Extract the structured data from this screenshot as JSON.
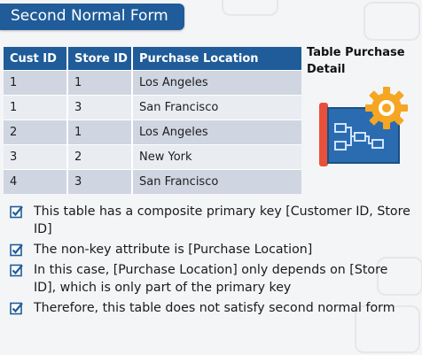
{
  "slide": {
    "title": "Second Normal Form",
    "table_label": "Table Purchase Detail"
  },
  "table": {
    "headers": [
      "Cust ID",
      "Store ID",
      "Purchase Location"
    ],
    "rows": [
      [
        "1",
        "1",
        "Los Angeles"
      ],
      [
        "1",
        "3",
        "San Francisco"
      ],
      [
        "2",
        "1",
        "Los Angeles"
      ],
      [
        "3",
        "2",
        "New York"
      ],
      [
        "4",
        "3",
        "San Francisco"
      ]
    ]
  },
  "bullets": [
    "This table has a composite primary key [Customer ID, Store ID]",
    "The non-key attribute is [Purchase Location]",
    "In this case, [Purchase Location] only depends on [Store ID], which is only part of the primary key",
    "Therefore, this table does not satisfy second normal form"
  ],
  "colors": {
    "accent": "#1f5c99",
    "row_dark": "#cfd5e1",
    "row_light": "#e9ecf1",
    "gear": "#f5a623",
    "blueprint_red": "#e8503a"
  },
  "icons": {
    "bullet": "checkbox-checked-icon",
    "illustration": "blueprint-gear-icon"
  }
}
